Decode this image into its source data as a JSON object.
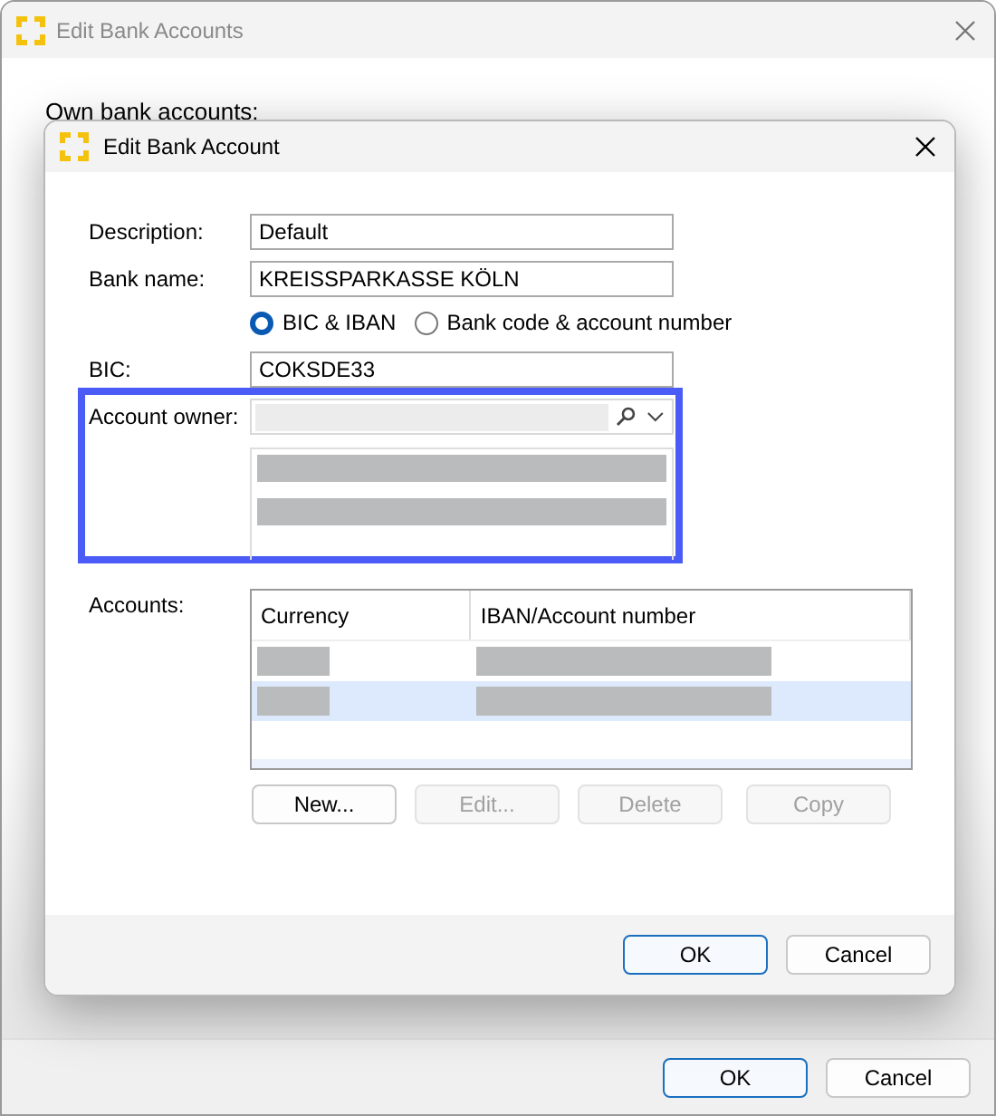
{
  "outer_window": {
    "title": "Edit Bank Accounts",
    "active": false,
    "section_label": "Own bank accounts:",
    "buttons": [
      {
        "label": "OK",
        "default": true
      },
      {
        "label": "Cancel",
        "default": false
      }
    ]
  },
  "dialog": {
    "title": "Edit Bank Account",
    "fields": [
      {
        "label": "Description:",
        "value": "Default"
      },
      {
        "label": "Bank name:",
        "value": "KREISSPARKASSE KÖLN"
      }
    ],
    "mode_options": [
      {
        "label": "BIC & IBAN",
        "selected": true
      },
      {
        "label": "Bank code & account number",
        "selected": false
      }
    ],
    "bic": {
      "label": "BIC:",
      "value": "COKSDE33"
    },
    "account_owner": {
      "label": "Account owner:",
      "highlighted": true
    },
    "accounts": {
      "label": "Accounts:",
      "columns": [
        "Currency",
        "IBAN/Account number"
      ],
      "rows": [
        {
          "selected": false
        },
        {
          "selected": true
        }
      ]
    },
    "account_buttons": [
      {
        "label": "New...",
        "disabled": false
      },
      {
        "label": "Edit...",
        "disabled": true
      },
      {
        "label": "Delete",
        "disabled": true
      },
      {
        "label": "Copy",
        "disabled": true
      }
    ],
    "buttons": [
      {
        "label": "OK",
        "default": true
      },
      {
        "label": "Cancel",
        "default": false
      }
    ]
  }
}
